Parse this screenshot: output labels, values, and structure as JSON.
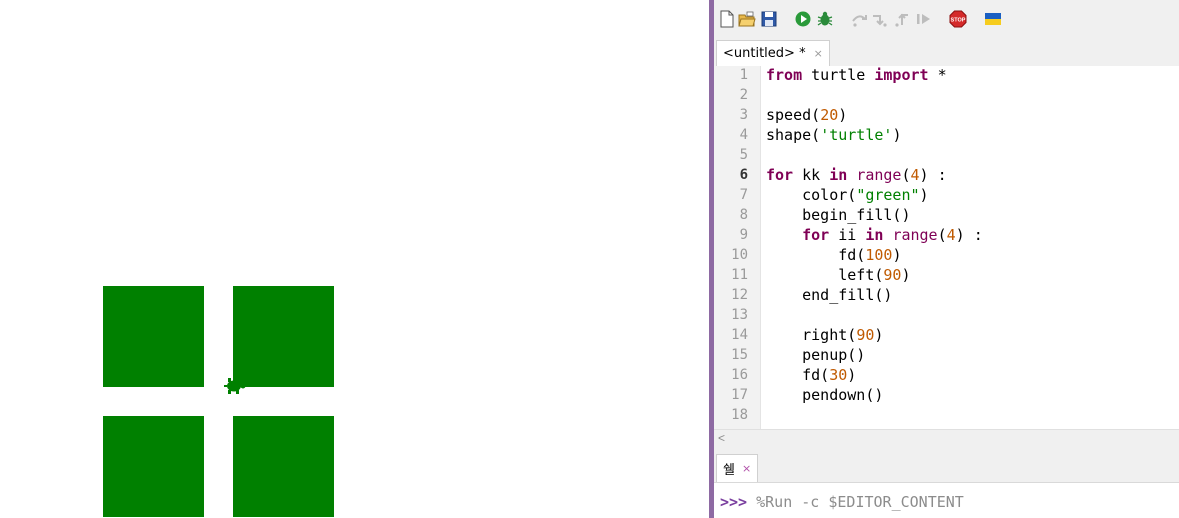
{
  "colors": {
    "fill": "#008000",
    "keyword": "#7f0055",
    "number": "#c05a00",
    "string": "#008000",
    "divider": "#8e6aa3"
  },
  "canvas": {
    "squares_count": 4,
    "turtle_icon": "turtle-icon"
  },
  "toolbar": {
    "icons": [
      "new-file-icon",
      "open-file-icon",
      "save-icon",
      "run-icon",
      "debug-icon",
      "step-over-icon",
      "step-into-icon",
      "step-out-icon",
      "resume-icon",
      "stop-icon",
      "ukraine-flag-icon"
    ]
  },
  "editor": {
    "tab_label": "<untitled> *",
    "tab_close": "×",
    "current_line": 6,
    "lines": [
      {
        "n": "1",
        "html_tokens": [
          {
            "t": "from",
            "c": "kw"
          },
          {
            "t": " turtle ",
            "c": ""
          },
          {
            "t": "import",
            "c": "kw"
          },
          {
            "t": " *",
            "c": ""
          }
        ]
      },
      {
        "n": "2",
        "html_tokens": []
      },
      {
        "n": "3",
        "html_tokens": [
          {
            "t": "speed(",
            "c": ""
          },
          {
            "t": "20",
            "c": "num"
          },
          {
            "t": ")",
            "c": ""
          }
        ]
      },
      {
        "n": "4",
        "html_tokens": [
          {
            "t": "shape(",
            "c": ""
          },
          {
            "t": "'turtle'",
            "c": "str"
          },
          {
            "t": ")",
            "c": ""
          }
        ]
      },
      {
        "n": "5",
        "html_tokens": []
      },
      {
        "n": "6",
        "html_tokens": [
          {
            "t": "for",
            "c": "kw"
          },
          {
            "t": " kk ",
            "c": ""
          },
          {
            "t": "in",
            "c": "kw"
          },
          {
            "t": " ",
            "c": ""
          },
          {
            "t": "range",
            "c": "bi"
          },
          {
            "t": "(",
            "c": ""
          },
          {
            "t": "4",
            "c": "num"
          },
          {
            "t": ") :",
            "c": ""
          }
        ]
      },
      {
        "n": "7",
        "html_tokens": [
          {
            "t": "    color(",
            "c": ""
          },
          {
            "t": "\"green\"",
            "c": "str"
          },
          {
            "t": ")",
            "c": ""
          }
        ]
      },
      {
        "n": "8",
        "html_tokens": [
          {
            "t": "    begin_fill()",
            "c": ""
          }
        ]
      },
      {
        "n": "9",
        "html_tokens": [
          {
            "t": "    ",
            "c": ""
          },
          {
            "t": "for",
            "c": "kw"
          },
          {
            "t": " ii ",
            "c": ""
          },
          {
            "t": "in",
            "c": "kw"
          },
          {
            "t": " ",
            "c": ""
          },
          {
            "t": "range",
            "c": "bi"
          },
          {
            "t": "(",
            "c": ""
          },
          {
            "t": "4",
            "c": "num"
          },
          {
            "t": ") :",
            "c": ""
          }
        ]
      },
      {
        "n": "10",
        "html_tokens": [
          {
            "t": "        fd(",
            "c": ""
          },
          {
            "t": "100",
            "c": "num"
          },
          {
            "t": ")",
            "c": ""
          }
        ]
      },
      {
        "n": "11",
        "html_tokens": [
          {
            "t": "        left(",
            "c": ""
          },
          {
            "t": "90",
            "c": "num"
          },
          {
            "t": ")",
            "c": ""
          }
        ]
      },
      {
        "n": "12",
        "html_tokens": [
          {
            "t": "    end_fill()",
            "c": ""
          }
        ]
      },
      {
        "n": "13",
        "html_tokens": []
      },
      {
        "n": "14",
        "html_tokens": [
          {
            "t": "    right(",
            "c": ""
          },
          {
            "t": "90",
            "c": "num"
          },
          {
            "t": ")",
            "c": ""
          }
        ]
      },
      {
        "n": "15",
        "html_tokens": [
          {
            "t": "    penup()",
            "c": ""
          }
        ]
      },
      {
        "n": "16",
        "html_tokens": [
          {
            "t": "    fd(",
            "c": ""
          },
          {
            "t": "30",
            "c": "num"
          },
          {
            "t": ")",
            "c": ""
          }
        ]
      },
      {
        "n": "17",
        "html_tokens": [
          {
            "t": "    pendown()",
            "c": ""
          }
        ]
      },
      {
        "n": "18",
        "html_tokens": []
      }
    ]
  },
  "scrollbar": {
    "left_arrow": "<"
  },
  "shell": {
    "tab_label": "쉘",
    "tab_close": "×",
    "prompt": ">>>",
    "command": "%Run -c $EDITOR_CONTENT"
  }
}
